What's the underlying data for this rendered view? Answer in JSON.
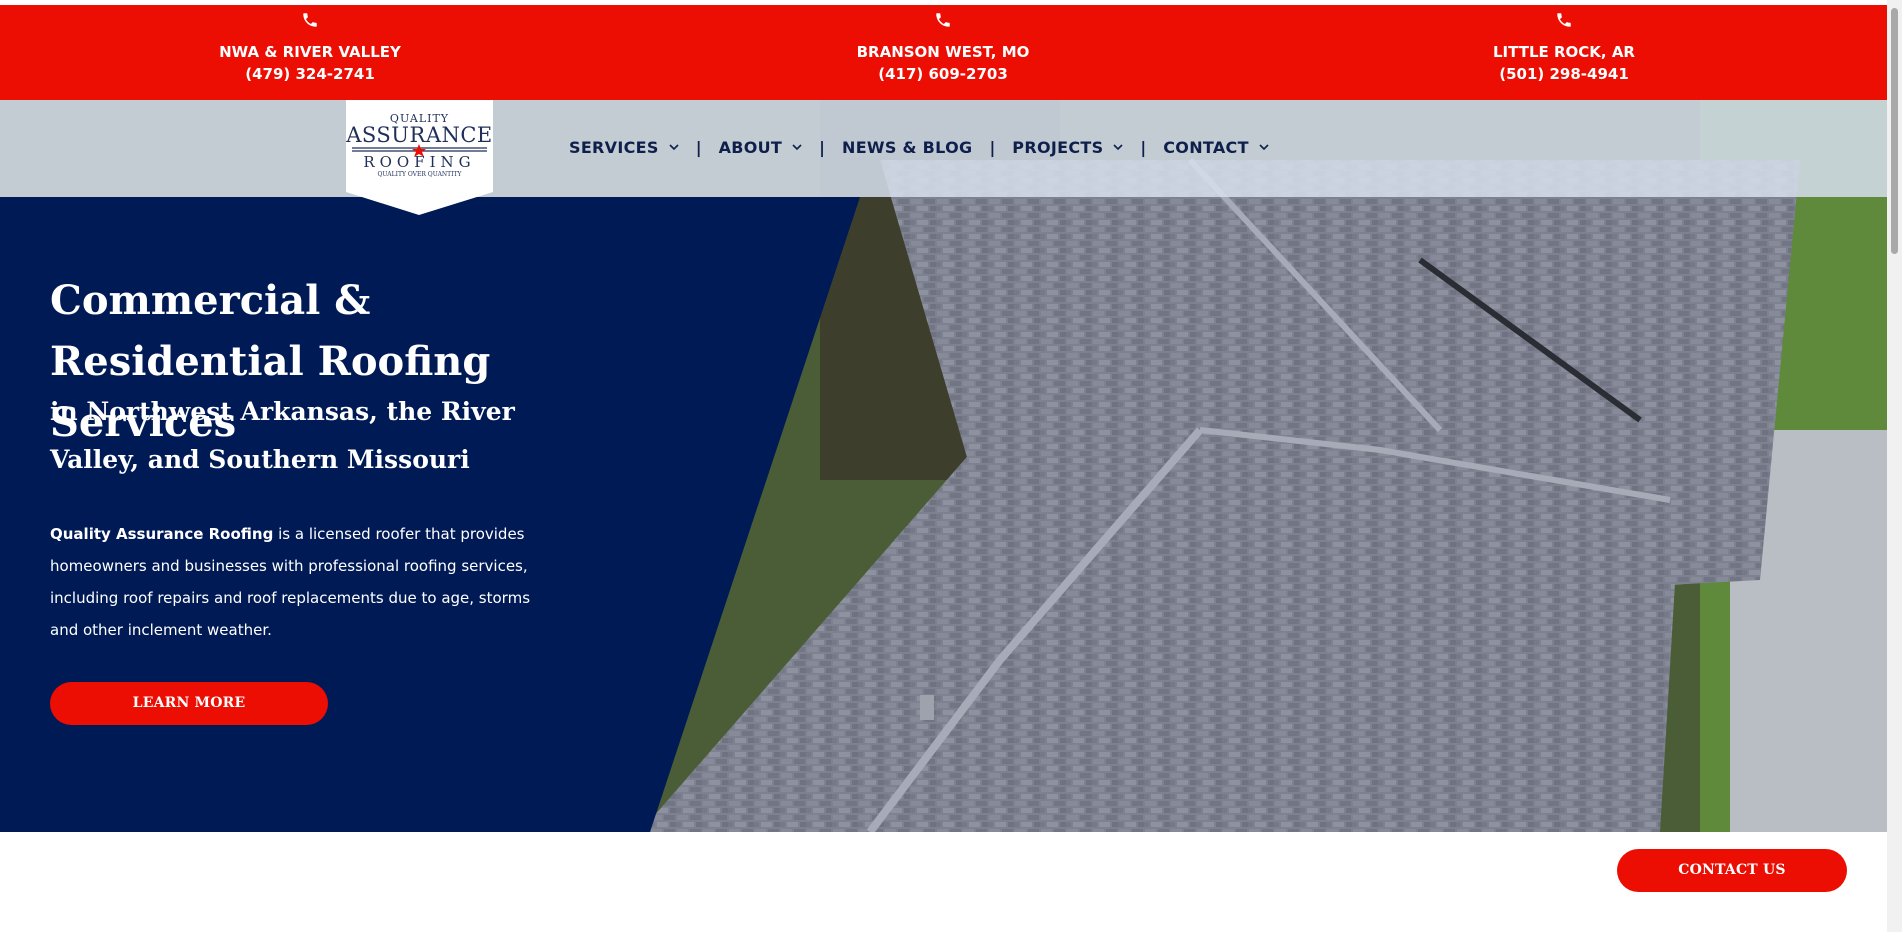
{
  "colors": {
    "brand_red": "#ec0d03",
    "navy": "#001a56",
    "nav_text": "#0f1f4c"
  },
  "locations": [
    {
      "name": "NWA & RIVER VALLEY",
      "phone": "(479) 324-2741",
      "icon": "phone-icon"
    },
    {
      "name": "BRANSON WEST, MO",
      "phone": "(417) 609-2703",
      "icon": "phone-icon"
    },
    {
      "name": "LITTLE ROCK, AR",
      "phone": "(501) 298-4941",
      "icon": "phone-icon"
    }
  ],
  "logo": {
    "line1": "QUALITY",
    "line2": "ASSURANCE",
    "line3": "ROOFING",
    "tagline": "QUALITY OVER QUANTITY"
  },
  "nav": {
    "services": "SERVICES",
    "about": "ABOUT",
    "news": "NEWS & BLOG",
    "projects": "PROJECTS",
    "contact": "CONTACT",
    "separator": "|"
  },
  "hero": {
    "headline": "Commercial & Residential Roofing Services",
    "subhead": "in Northwest Arkansas, the River Valley, and Southern Missouri",
    "intro_bold": "Quality Assurance Roofing",
    "intro_rest": " is a licensed roofer that provides homeowners and businesses with professional roofing services, including roof repairs and roof replacements due to age, storms and other inclement weather.",
    "cta": "LEARN MORE"
  },
  "floating_cta": "CONTACT US"
}
